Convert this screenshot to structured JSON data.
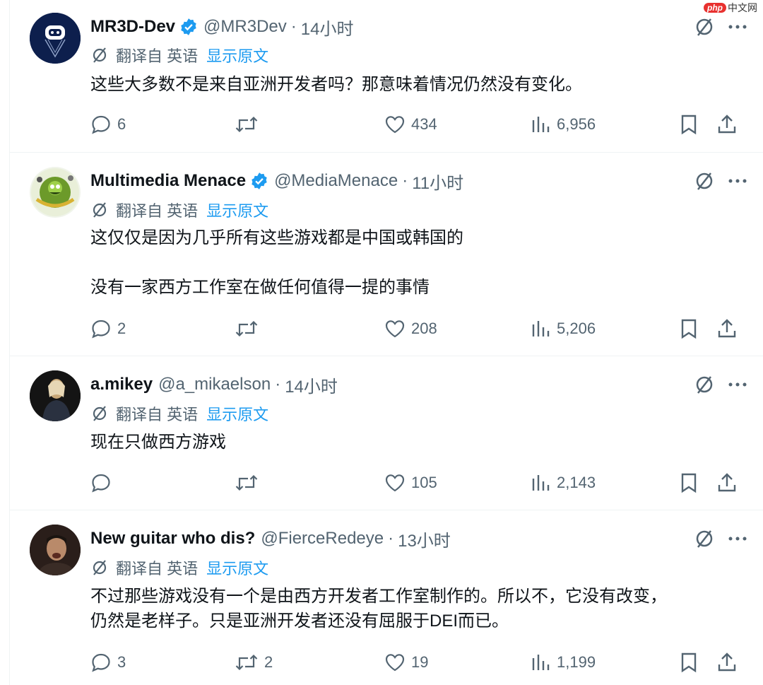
{
  "watermark": {
    "brand": "php",
    "site": "中文网"
  },
  "common": {
    "translate_label": "翻译自 英语",
    "show_original": "显示原文",
    "dot": "·"
  },
  "colors": {
    "accent": "#1d9bf0",
    "secondary_text": "#536471",
    "verified": "#1d9bf0"
  },
  "icons": [
    "grok-icon",
    "more-icon",
    "translate-icon",
    "reply-icon",
    "retweet-icon",
    "like-icon",
    "views-icon",
    "bookmark-icon",
    "share-icon",
    "verified-badge-icon"
  ],
  "tweets": [
    {
      "name": "MR3D-Dev",
      "verified": true,
      "handle": "@MR3Dev",
      "time": "14小时",
      "lines": [
        "这些大多数不是来自亚洲开发者吗？那意味着情况仍然没有变化。"
      ],
      "replies": "6",
      "retweets": "",
      "likes": "434",
      "views": "6,956"
    },
    {
      "name": "Multimedia Menace",
      "verified": true,
      "handle": "@MediaMenace",
      "time": "11小时",
      "lines": [
        "这仅仅是因为几乎所有这些游戏都是中国或韩国的",
        "",
        "没有一家西方工作室在做任何值得一提的事情"
      ],
      "replies": "2",
      "retweets": "",
      "likes": "208",
      "views": "5,206"
    },
    {
      "name": "a.mikey",
      "verified": false,
      "handle": "@a_mikaelson",
      "time": "14小时",
      "lines": [
        "现在只做西方游戏"
      ],
      "replies": "",
      "retweets": "",
      "likes": "105",
      "views": "2,143"
    },
    {
      "name": "New guitar who dis?",
      "verified": false,
      "handle": "@FierceRedeye",
      "time": "13小时",
      "lines": [
        "不过那些游戏没有一个是由西方开发者工作室制作的。所以不，它没有改变，",
        "仍然是老样子。只是亚洲开发者还没有屈服于DEI而已。"
      ],
      "replies": "3",
      "retweets": "2",
      "likes": "19",
      "views": "1,199"
    }
  ]
}
